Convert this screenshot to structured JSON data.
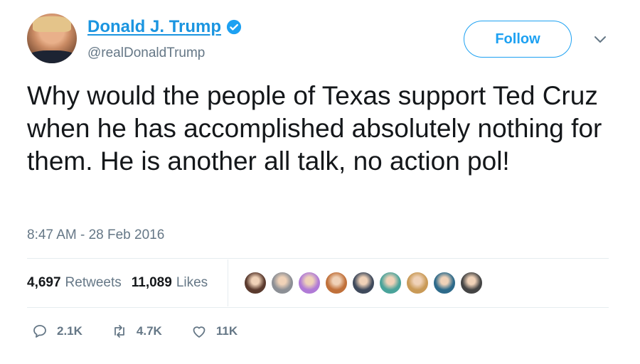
{
  "user": {
    "name": "Donald J. Trump",
    "handle": "@realDonaldTrump",
    "verified": true
  },
  "follow_label": "Follow",
  "tweet": {
    "text": "Why would the people of Texas support Ted Cruz when he has accomplished absolutely nothing for them. He is another all talk, no action pol!",
    "timestamp": "8:47 AM - 28 Feb 2016"
  },
  "stats": {
    "retweets_count": "4,697",
    "retweets_label": "Retweets",
    "likes_count": "11,089",
    "likes_label": "Likes"
  },
  "liker_avatar_colors": [
    "#5a3a2e",
    "#8c8f95",
    "#b07ad6",
    "#c0703a",
    "#3f4a5c",
    "#4aa39a",
    "#c99a57",
    "#2d6a8a",
    "#444444"
  ],
  "actions": {
    "reply_count": "2.1K",
    "retweet_count": "4.7K",
    "like_count": "11K"
  },
  "colors": {
    "brand_blue": "#1da1f2",
    "name_blue": "#1b95e0",
    "muted": "#657786"
  }
}
